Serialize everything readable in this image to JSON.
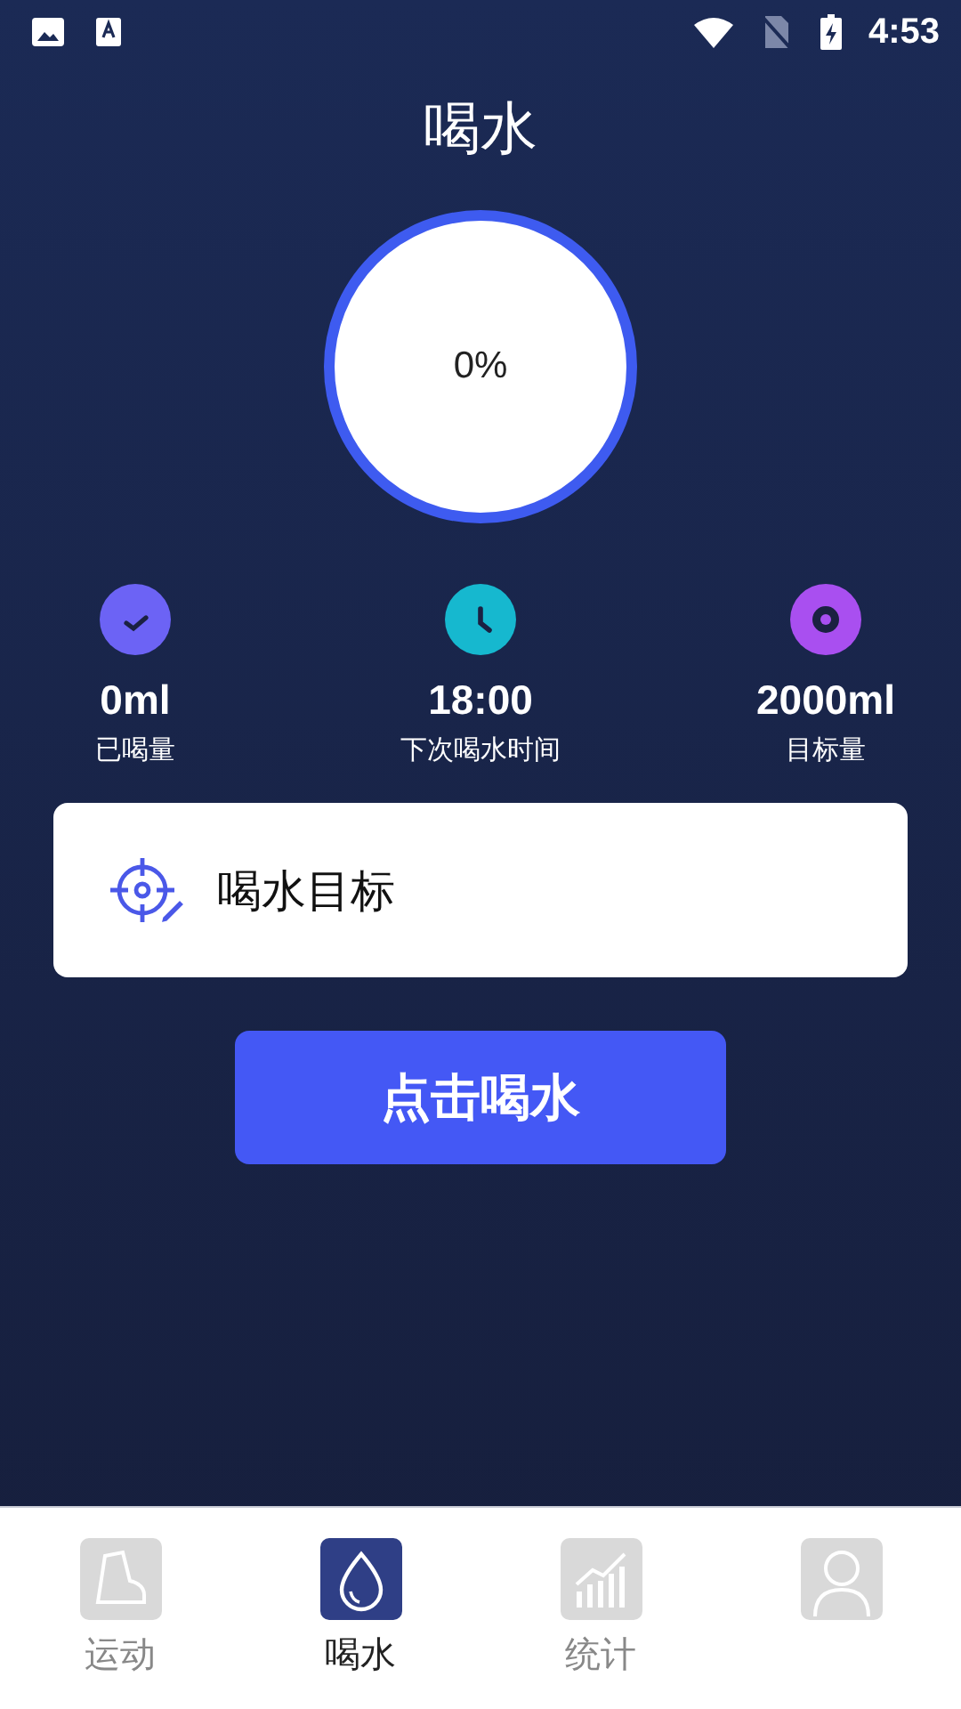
{
  "status_bar": {
    "time": "4:53"
  },
  "title": "喝水",
  "progress": {
    "percent": "0%",
    "level": 0
  },
  "stats": [
    {
      "kind": "check",
      "value": "0ml",
      "label": "已喝量"
    },
    {
      "kind": "clock",
      "value": "18:00",
      "label": "下次喝水时间"
    },
    {
      "kind": "target",
      "value": "2000ml",
      "label": "目标量"
    }
  ],
  "goal_card": {
    "label": "喝水目标"
  },
  "drink_button": {
    "label": "点击喝水"
  },
  "tabs": [
    {
      "kind": "shoe",
      "label": "运动",
      "selected": false
    },
    {
      "kind": "drop",
      "label": "喝水",
      "selected": true
    },
    {
      "kind": "chart",
      "label": "统计",
      "selected": false
    },
    {
      "kind": "person",
      "selected": false
    }
  ]
}
